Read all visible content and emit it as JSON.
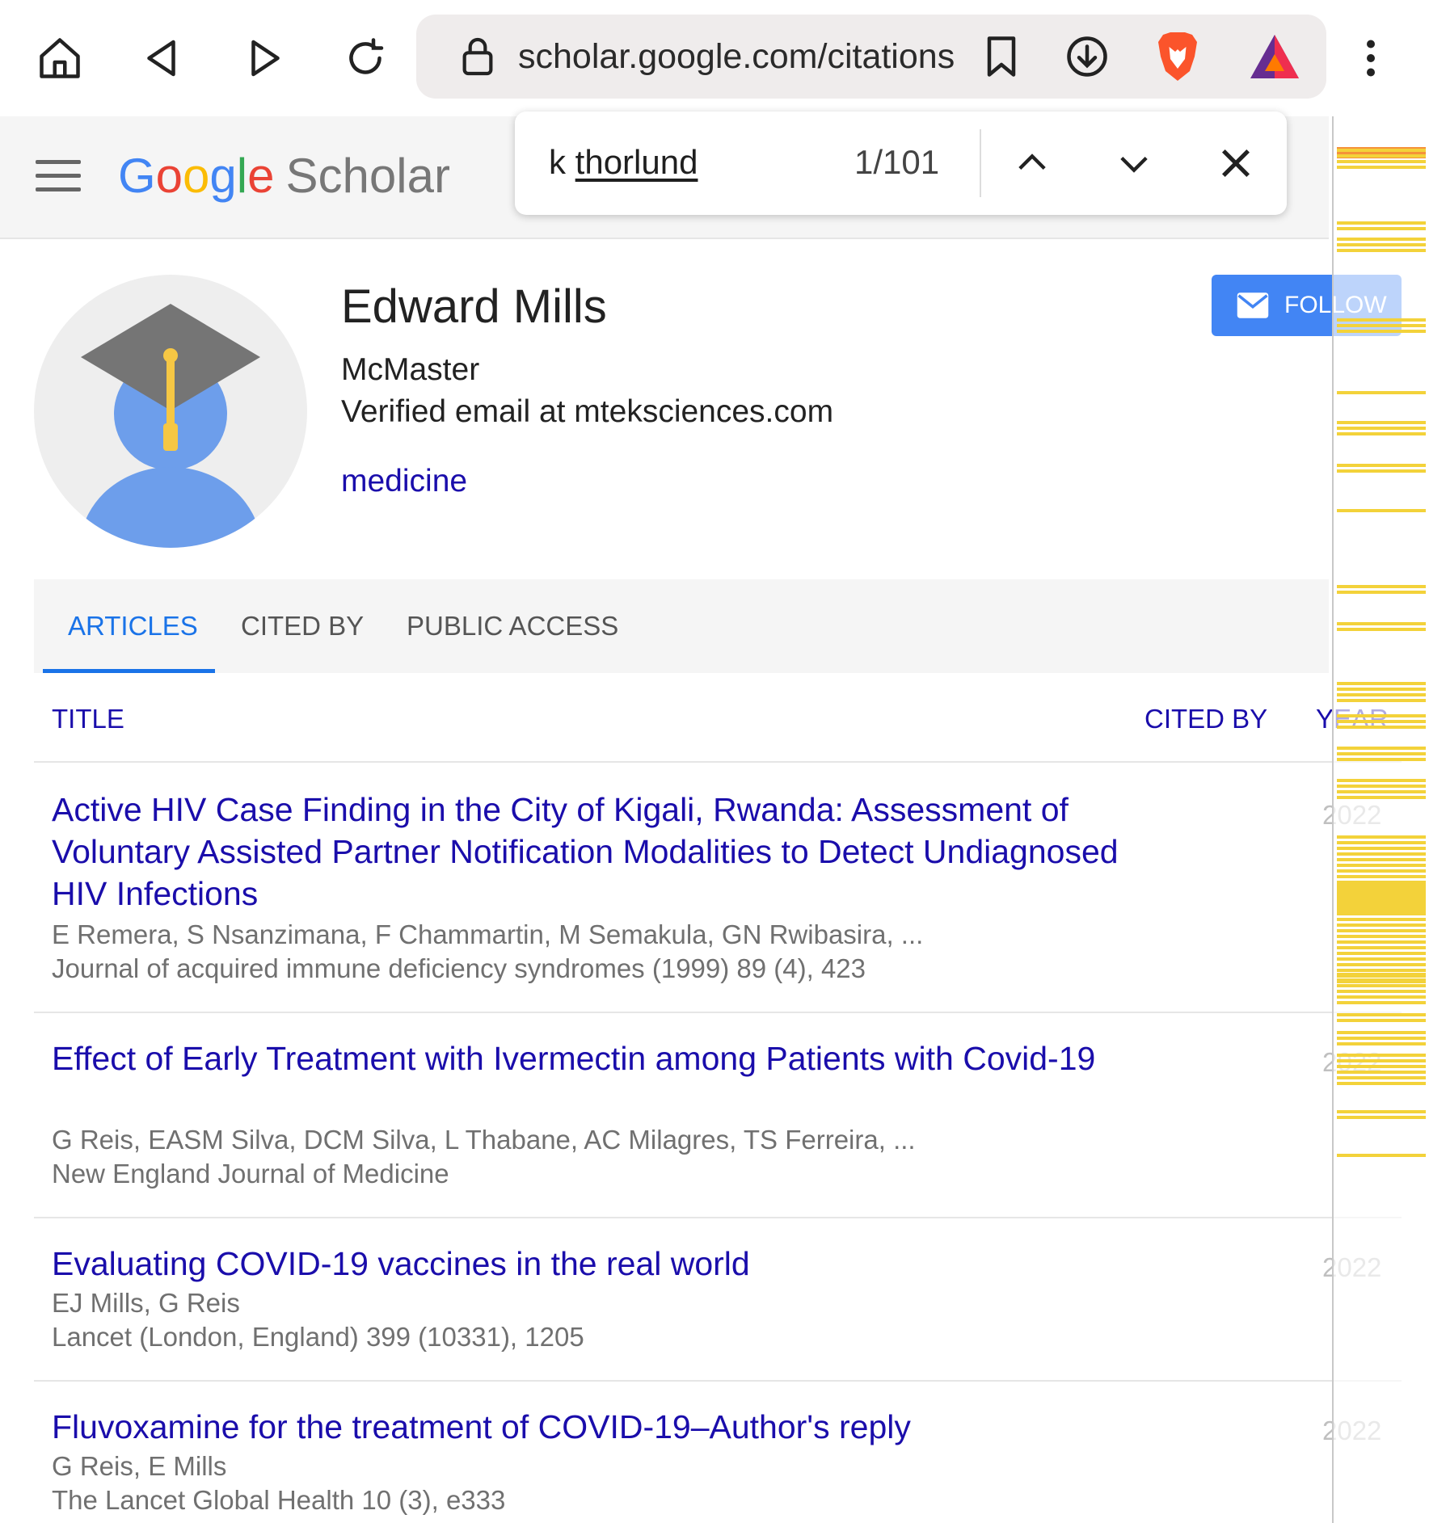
{
  "browser": {
    "url": "scholar.google.com/citations",
    "icons": [
      "home-icon",
      "back-icon",
      "forward-icon",
      "reload-icon",
      "lock-icon",
      "bookmark-icon",
      "download-icon",
      "brave-lion-icon",
      "brave-rewards-icon",
      "more-vert-icon"
    ]
  },
  "find": {
    "query_prefix": "k ",
    "query_word": "thorlund",
    "count": "1/101"
  },
  "header": {
    "logo_letters": [
      "G",
      "o",
      "o",
      "g",
      "l",
      "e"
    ],
    "logo_suffix": "Scholar"
  },
  "profile": {
    "name": "Edward Mills",
    "affiliation": "McMaster",
    "email": "Verified email at mteksciences.com",
    "interest": "medicine",
    "follow_label": "FOLLOW"
  },
  "tabs": [
    {
      "label": "ARTICLES",
      "active": true
    },
    {
      "label": "CITED BY",
      "active": false
    },
    {
      "label": "PUBLIC ACCESS",
      "active": false
    }
  ],
  "table": {
    "col_title": "TITLE",
    "col_cited": "CITED BY",
    "col_year": "YEAR"
  },
  "articles": [
    {
      "title": "Active HIV Case Finding in the City of Kigali, Rwanda: Assessment of Voluntary Assisted Partner Notification Modalities to Detect Undiagnosed HIV Infections",
      "authors": "E Remera, S Nsanzimana, F Chammartin, M Semakula, GN Rwibasira, ...",
      "venue": "Journal of acquired immune deficiency syndromes (1999) 89 (4), 423",
      "year": "2022"
    },
    {
      "title": "Effect of Early Treatment with Ivermectin among Patients with Covid-19",
      "authors": "G Reis, EASM Silva, DCM Silva, L Thabane, AC Milagres, TS Ferreira, ...",
      "venue": "New England Journal of Medicine",
      "year": "2022"
    },
    {
      "title": "Evaluating COVID-19 vaccines in the real world",
      "authors": "EJ Mills, G Reis",
      "venue": "Lancet (London, England) 399 (10331), 1205",
      "year": "2022"
    },
    {
      "title": "Fluvoxamine for the treatment of COVID-19–Author's reply",
      "authors": "G Reis, E Mills",
      "venue": "The Lancet Global Health 10 (3), e333",
      "year": "2022"
    }
  ],
  "colors": {
    "link": "#1a0dab",
    "tab_active": "#1a73e8",
    "follow": "#4285f4",
    "find_mark": "#f3d23a",
    "find_mark_current": "#f5923a"
  }
}
